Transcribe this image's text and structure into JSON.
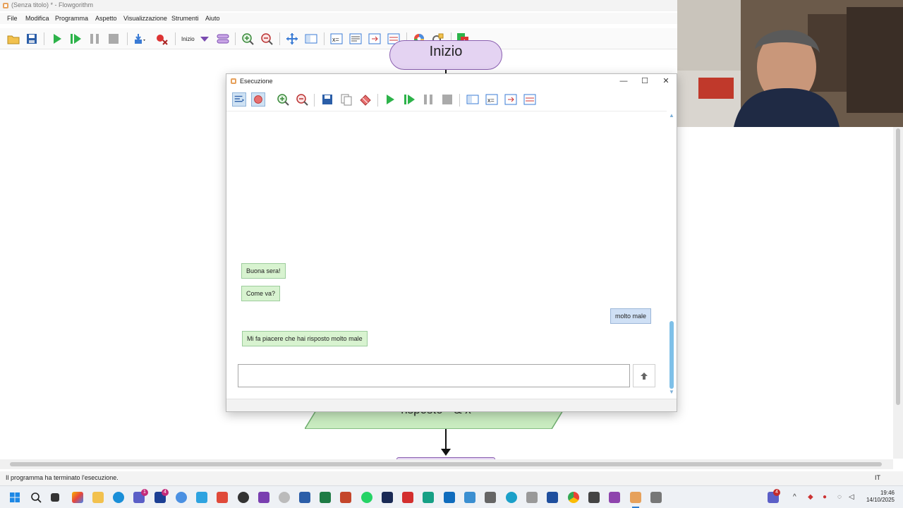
{
  "window": {
    "title": "(Senza titolo) * - Flowgorithm"
  },
  "menu": [
    "File",
    "Modifica",
    "Programma",
    "Aspetto",
    "Visualizzazione",
    "Strumenti",
    "Aiuto"
  ],
  "toolbar": {
    "function_select": "Inizio"
  },
  "canvas": {
    "start_label": "Inizio",
    "output_label": "risposto \" & x"
  },
  "dialog": {
    "title": "Esecuzione",
    "messages": [
      {
        "sender": "program",
        "text": "Buona sera!"
      },
      {
        "sender": "program",
        "text": "Come va?"
      },
      {
        "sender": "user",
        "text": "molto male"
      },
      {
        "sender": "program",
        "text": "Mi fa piacere che hai risposto molto male"
      }
    ],
    "input": {
      "value": "",
      "placeholder": ""
    },
    "send_icon": "up-arrow-icon",
    "window_controls": {
      "minimize": "—",
      "maximize": "☐",
      "close": "✕"
    }
  },
  "status": {
    "message": "Il programma ha terminato l'esecuzione.",
    "language": "IT"
  },
  "taskbar": {
    "clock_time": "19:46",
    "clock_date": "14/10/2025",
    "badges": {
      "teams": "1",
      "launcher": "4",
      "tray": "4"
    }
  },
  "colors": {
    "start_fill": "#e4d3f2",
    "start_border": "#8a5fb0",
    "io_fill": "#c9ecc0",
    "io_border": "#6fae6f",
    "program_bubble": "#d8f3d0",
    "user_bubble": "#cfe0f5",
    "accent": "#2f7fd3"
  }
}
